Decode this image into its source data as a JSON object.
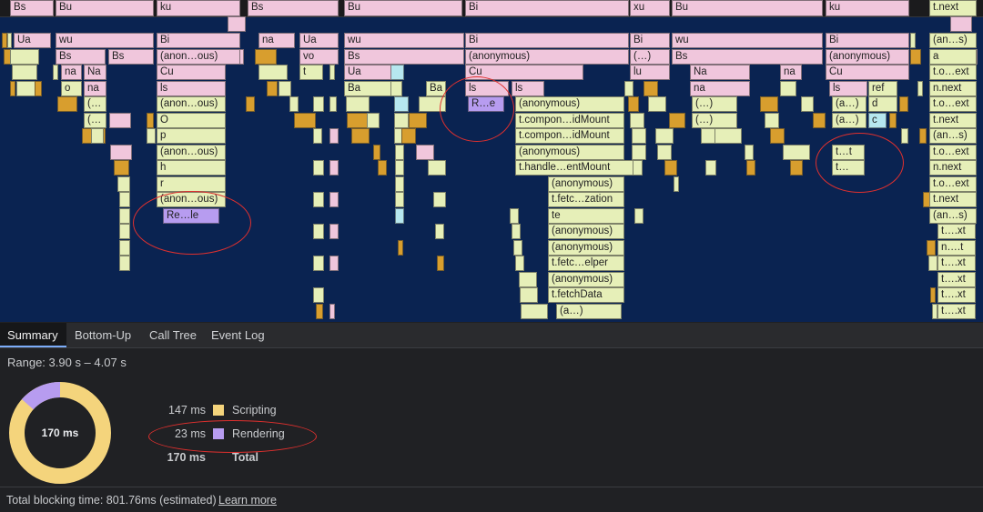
{
  "flame": {
    "blocks": [
      {
        "label": "Bs",
        "c": "pk"
      },
      {
        "label": "Bu",
        "c": "pk"
      },
      {
        "label": "ku",
        "c": "pk"
      },
      {
        "label": "Bs",
        "c": "pk"
      },
      {
        "label": "Bu",
        "c": "pk"
      },
      {
        "label": "Bi",
        "c": "pk"
      },
      {
        "label": "xu",
        "c": "pk"
      },
      {
        "label": "Bu",
        "c": "pk"
      },
      {
        "label": "ku",
        "c": "pk"
      },
      {
        "label": "t.next",
        "c": "yg"
      },
      {
        "label": "Ua",
        "c": "pk"
      },
      {
        "label": "wu",
        "c": "pk"
      },
      {
        "label": "Bi",
        "c": "pk"
      },
      {
        "label": "na",
        "c": "pk"
      },
      {
        "label": "Ua",
        "c": "pk"
      },
      {
        "label": "wu",
        "c": "pk"
      },
      {
        "label": "Bi",
        "c": "pk"
      },
      {
        "label": "Bi",
        "c": "pk"
      },
      {
        "label": "wu",
        "c": "pk"
      },
      {
        "label": "Bi",
        "c": "pk"
      },
      {
        "label": "(an…s)",
        "c": "yg"
      },
      {
        "label": "Bs",
        "c": "pk"
      },
      {
        "label": "Bs",
        "c": "pk"
      },
      {
        "label": "(anon…ous)",
        "c": "pk"
      },
      {
        "label": "vo",
        "c": "pk"
      },
      {
        "label": "Bs",
        "c": "pk"
      },
      {
        "label": "(anonymous)",
        "c": "pk"
      },
      {
        "label": "(…)",
        "c": "pk"
      },
      {
        "label": "Bs",
        "c": "pk"
      },
      {
        "label": "(anonymous)",
        "c": "pk"
      },
      {
        "label": "a",
        "c": "yg"
      },
      {
        "label": "na",
        "c": "pk"
      },
      {
        "label": "Na",
        "c": "pk"
      },
      {
        "label": "Cu",
        "c": "pk"
      },
      {
        "label": "t",
        "c": "yg"
      },
      {
        "label": "Ua",
        "c": "pk"
      },
      {
        "label": "Cu",
        "c": "pk"
      },
      {
        "label": "lu",
        "c": "pk"
      },
      {
        "label": "Na",
        "c": "pk"
      },
      {
        "label": "na",
        "c": "pk"
      },
      {
        "label": "Cu",
        "c": "pk"
      },
      {
        "label": "t.o…ext",
        "c": "yg"
      },
      {
        "label": "o",
        "c": "yg"
      },
      {
        "label": "na",
        "c": "pk"
      },
      {
        "label": "ls",
        "c": "pk"
      },
      {
        "label": "Ba",
        "c": "yg"
      },
      {
        "label": "Ba",
        "c": "yg"
      },
      {
        "label": "ls",
        "c": "pk"
      },
      {
        "label": "ls",
        "c": "pk"
      },
      {
        "label": "na",
        "c": "pk"
      },
      {
        "label": "ls",
        "c": "pk"
      },
      {
        "label": "ref",
        "c": "yg"
      },
      {
        "label": "n.next",
        "c": "yg"
      },
      {
        "label": "(…",
        "c": "yg"
      },
      {
        "label": "(anon…ous)",
        "c": "yg"
      },
      {
        "label": "R…e",
        "c": "pu"
      },
      {
        "label": "(anonymous)",
        "c": "yg"
      },
      {
        "label": "(…)",
        "c": "yg"
      },
      {
        "label": "(a…)",
        "c": "yg"
      },
      {
        "label": "d",
        "c": "yg"
      },
      {
        "label": "t.o…ext",
        "c": "yg"
      },
      {
        "label": "(…",
        "c": "yg"
      },
      {
        "label": "O",
        "c": "yg"
      },
      {
        "label": "t.compon…idMount",
        "c": "yg"
      },
      {
        "label": "(…)",
        "c": "yg"
      },
      {
        "label": "(a…)",
        "c": "yg"
      },
      {
        "label": "c",
        "c": "cy"
      },
      {
        "label": "t.next",
        "c": "yg"
      },
      {
        "label": "p",
        "c": "yg"
      },
      {
        "label": "t.compon…idMount",
        "c": "yg"
      },
      {
        "label": "(an…s)",
        "c": "yg"
      },
      {
        "label": "(anon…ous)",
        "c": "yg"
      },
      {
        "label": "(anonymous)",
        "c": "yg"
      },
      {
        "label": "t…t",
        "c": "yg"
      },
      {
        "label": "t.o…ext",
        "c": "yg"
      },
      {
        "label": "h",
        "c": "yg"
      },
      {
        "label": "t.handle…entMount",
        "c": "yg"
      },
      {
        "label": "t…",
        "c": "yg"
      },
      {
        "label": "n.next",
        "c": "yg"
      },
      {
        "label": "r",
        "c": "yg"
      },
      {
        "label": "(anonymous)",
        "c": "yg"
      },
      {
        "label": "t.o…ext",
        "c": "yg"
      },
      {
        "label": "(anon…ous)",
        "c": "yg"
      },
      {
        "label": "t.fetc…zation",
        "c": "yg"
      },
      {
        "label": "t.next",
        "c": "yg"
      },
      {
        "label": "Re…le",
        "c": "pu"
      },
      {
        "label": "te",
        "c": "yg"
      },
      {
        "label": "(an…s)",
        "c": "yg"
      },
      {
        "label": "(anonymous)",
        "c": "yg"
      },
      {
        "label": "t….xt",
        "c": "yg"
      },
      {
        "label": "(anonymous)",
        "c": "yg"
      },
      {
        "label": "n….t",
        "c": "yg"
      },
      {
        "label": "t.fetc…elper",
        "c": "yg"
      },
      {
        "label": "t….xt",
        "c": "yg"
      },
      {
        "label": "(anonymous)",
        "c": "yg"
      },
      {
        "label": "t….xt",
        "c": "yg"
      },
      {
        "label": "t.fetchData",
        "c": "yg"
      },
      {
        "label": "t….xt",
        "c": "yg"
      },
      {
        "label": "(a…)",
        "c": "yg"
      },
      {
        "label": "t….xt",
        "c": "yg"
      }
    ]
  },
  "tabs": [
    "Summary",
    "Bottom-Up",
    "Call Tree",
    "Event Log"
  ],
  "summary": {
    "range": "Range: 3.90 s – 4.07 s",
    "total_center": "170 ms",
    "legend": [
      {
        "ms": "147 ms",
        "label": "Scripting",
        "color": "#f4d47c",
        "value": 147
      },
      {
        "ms": "23 ms",
        "label": "Rendering",
        "color": "#b79cf0",
        "value": 23
      },
      {
        "ms": "170 ms",
        "label": "Total",
        "color": null,
        "value": 170
      }
    ]
  },
  "footer": {
    "text": "Total blocking time: 801.76ms (estimated)",
    "link": "Learn more"
  }
}
